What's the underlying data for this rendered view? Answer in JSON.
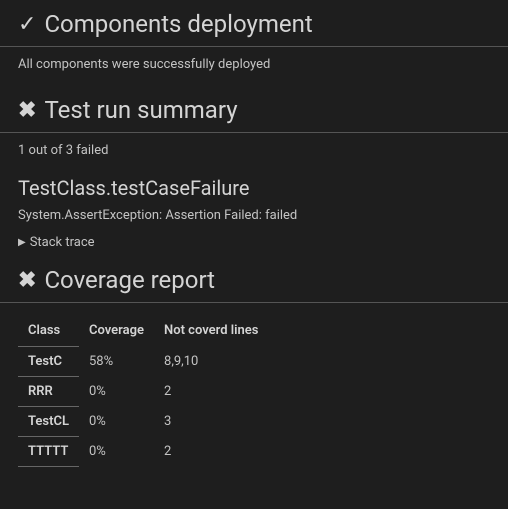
{
  "sections": {
    "deployment": {
      "icon": "✓",
      "title": "Components deployment",
      "message": "All components were successfully deployed"
    },
    "test_summary": {
      "icon": "✖",
      "title": "Test run summary",
      "message": "1 out of 3 failed",
      "failed_test": "TestClass.testCaseFailure",
      "exception": "System.AssertException: Assertion Failed: failed",
      "stack_trace_label": "Stack trace"
    },
    "coverage": {
      "icon": "✖",
      "title": "Coverage report",
      "headers": {
        "class": "Class",
        "coverage": "Coverage",
        "not_covered": "Not coverd lines"
      },
      "rows": [
        {
          "class": "TestC",
          "coverage": "58%",
          "not_covered": "8,9,10"
        },
        {
          "class": "RRR",
          "coverage": "0%",
          "not_covered": "2"
        },
        {
          "class": "TestCL",
          "coverage": "0%",
          "not_covered": "3"
        },
        {
          "class": "TTTTT",
          "coverage": "0%",
          "not_covered": "2"
        }
      ]
    }
  },
  "chart_data": {
    "type": "table",
    "title": "Coverage report",
    "columns": [
      "Class",
      "Coverage",
      "Not coverd lines"
    ],
    "rows": [
      [
        "TestC",
        "58%",
        "8,9,10"
      ],
      [
        "RRR",
        "0%",
        "2"
      ],
      [
        "TestCL",
        "0%",
        "3"
      ],
      [
        "TTTTT",
        "0%",
        "2"
      ]
    ]
  }
}
